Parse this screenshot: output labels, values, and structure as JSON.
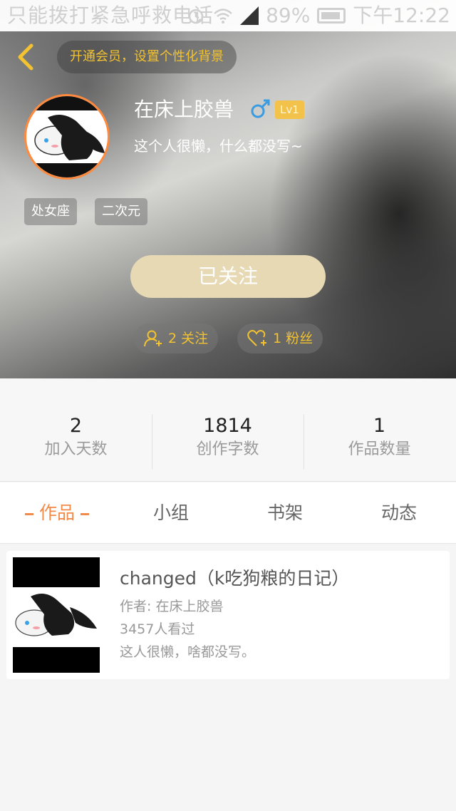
{
  "status_bar": {
    "carrier_text": "只能拨打紧急呼救电话",
    "battery": "89%",
    "time": "下午12:22"
  },
  "header": {
    "vip_prompt": "开通会员，设置个性化背景",
    "username": "在床上胶兽",
    "gender_icon": "male-icon",
    "level": "Lv1",
    "bio": "这个人很懒，什么都没写~",
    "tags": [
      "处女座",
      "二次元"
    ],
    "follow_button": "已关注",
    "following": "2 关注",
    "fans": "1 粉丝",
    "accent_color": "#f2c230"
  },
  "stats": [
    {
      "value": "2",
      "label": "加入天数"
    },
    {
      "value": "1814",
      "label": "创作字数"
    },
    {
      "value": "1",
      "label": "作品数量"
    }
  ],
  "tabs": [
    {
      "label": "作品",
      "active": true
    },
    {
      "label": "小组",
      "active": false
    },
    {
      "label": "书架",
      "active": false
    },
    {
      "label": "动态",
      "active": false
    }
  ],
  "works": [
    {
      "title": "changed（k吃狗粮的日记）",
      "author": "作者: 在床上胶兽",
      "views": "3457人看过",
      "description": "这人很懒，啥都没写。"
    }
  ],
  "colors": {
    "tab_active": "#f28a4a",
    "follow_button_bg": "#e6d9b4",
    "avatar_border": "#ff8a3d"
  }
}
